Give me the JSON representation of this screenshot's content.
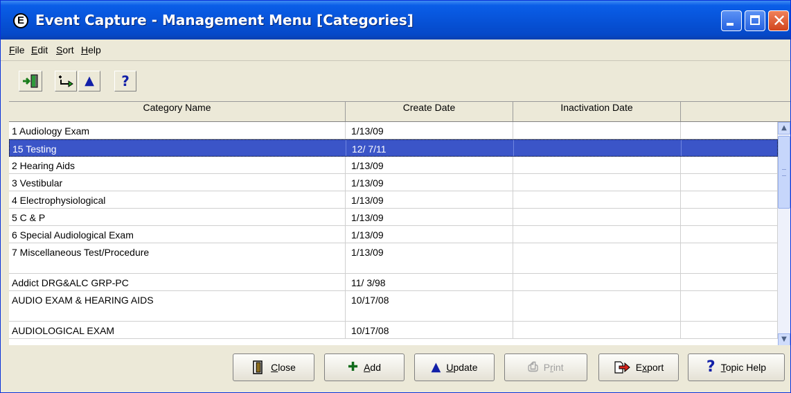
{
  "window": {
    "title": "Event Capture - Management Menu [Categories]",
    "app_icon_letter": "E"
  },
  "menu": {
    "items": [
      {
        "mnemonic": "F",
        "rest": "ile"
      },
      {
        "mnemonic": "E",
        "rest": "dit"
      },
      {
        "mnemonic": "S",
        "rest": "ort"
      },
      {
        "mnemonic": "H",
        "rest": "elp"
      }
    ]
  },
  "toolbar": {
    "help_glyph": "?",
    "up_glyph": "▲"
  },
  "table": {
    "columns": [
      "Category Name",
      "Create Date",
      "Inactivation Date",
      ""
    ],
    "rows": [
      {
        "name": "1 Audiology Exam",
        "create": "1/13/09",
        "inactive": "",
        "extra": ""
      },
      {
        "name": "15 Testing",
        "create": "12/ 7/11",
        "inactive": "",
        "extra": "",
        "selected": true
      },
      {
        "name": "2 Hearing Aids",
        "create": "1/13/09",
        "inactive": "",
        "extra": ""
      },
      {
        "name": "3 Vestibular",
        "create": "1/13/09",
        "inactive": "",
        "extra": ""
      },
      {
        "name": "4 Electrophysiological",
        "create": "1/13/09",
        "inactive": "",
        "extra": ""
      },
      {
        "name": "5 C & P",
        "create": "1/13/09",
        "inactive": "",
        "extra": ""
      },
      {
        "name": "6 Special Audiological Exam",
        "create": "1/13/09",
        "inactive": "",
        "extra": ""
      },
      {
        "name": "7 Miscellaneous Test/Procedure",
        "create": "1/13/09",
        "inactive": "",
        "extra": ""
      },
      {
        "name": "Addict DRG&ALC GRP-PC",
        "create": "11/ 3/98",
        "inactive": "",
        "extra": ""
      },
      {
        "name": "AUDIO EXAM & HEARING AIDS",
        "create": "10/17/08",
        "inactive": "",
        "extra": ""
      },
      {
        "name": "AUDIOLOGICAL EXAM",
        "create": "10/17/08",
        "inactive": "",
        "extra": ""
      }
    ]
  },
  "buttons": {
    "close": {
      "mnemonic": "C",
      "rest": "lose"
    },
    "add": {
      "mnemonic": "A",
      "rest": "dd"
    },
    "update": {
      "mnemonic": "U",
      "rest": "pdate"
    },
    "print": {
      "before": "P",
      "mnemonic": "r",
      "rest": "int"
    },
    "export": {
      "before": "E",
      "mnemonic": "x",
      "rest": "port"
    },
    "topic_help": {
      "mnemonic": "T",
      "rest": "opic Help",
      "glyph": "?"
    }
  },
  "colors": {
    "selection": "#3b55c8",
    "titlebar": "#0753d8",
    "face": "#ece9d8"
  }
}
